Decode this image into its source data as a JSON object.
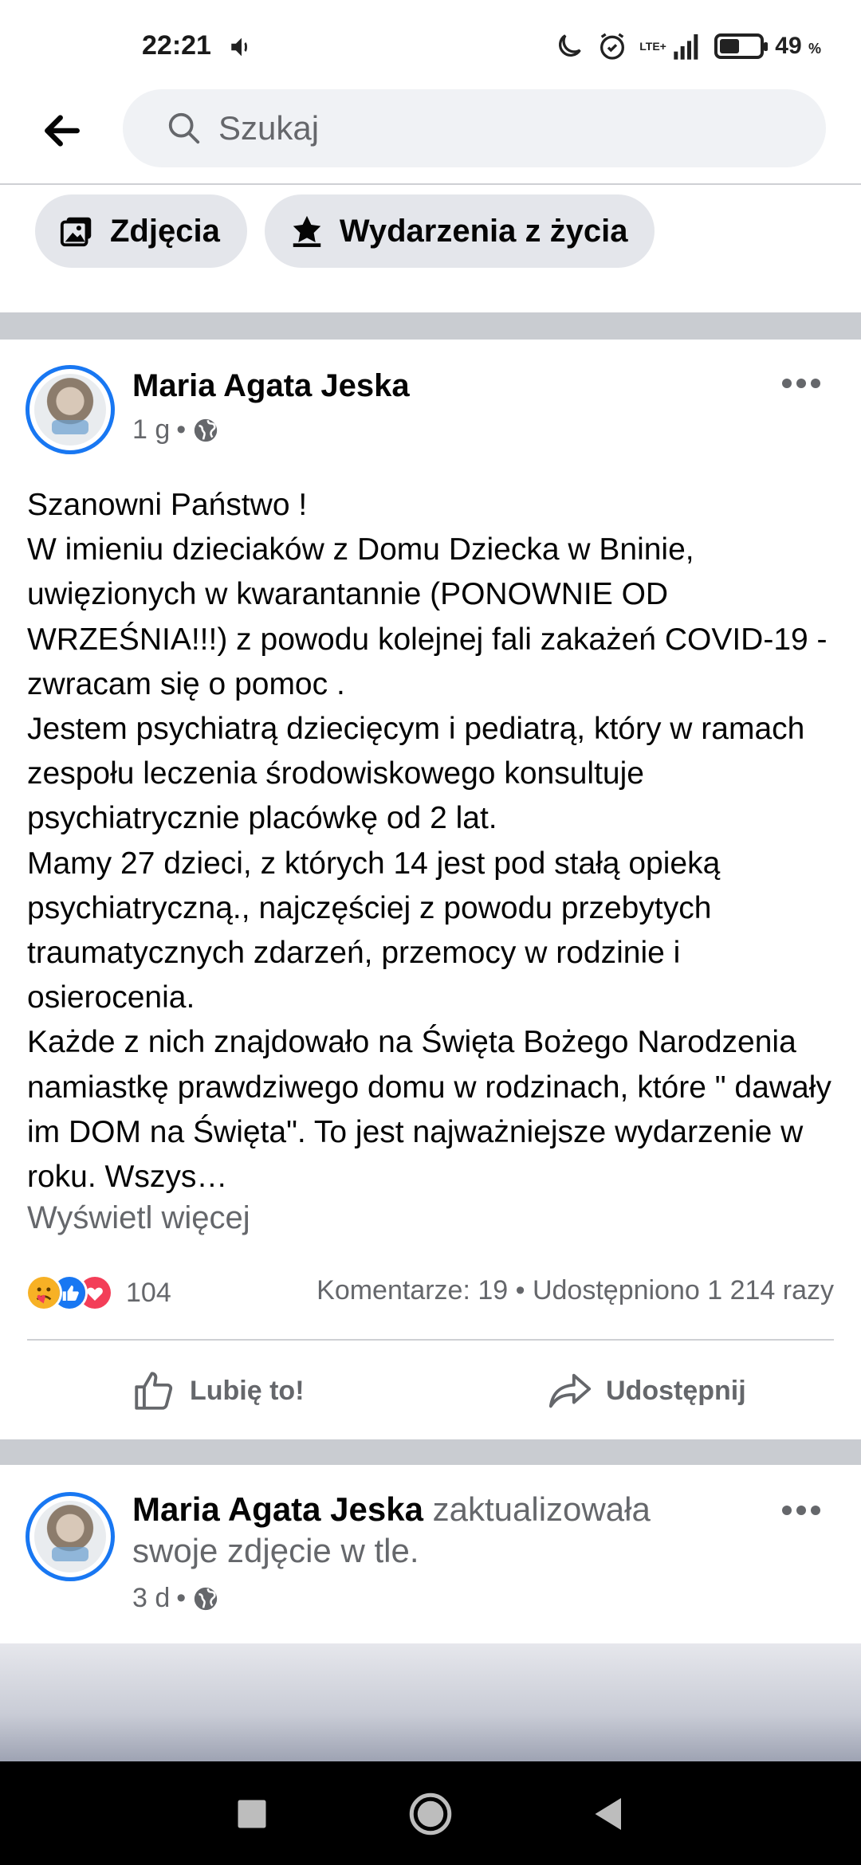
{
  "status_bar": {
    "time": "22:21",
    "network": "LTE+",
    "battery_percent": "49",
    "battery_unit": "%",
    "battery_level": 0.49,
    "icons": [
      "volume-icon",
      "moon-icon",
      "alarm-icon",
      "signal-icon",
      "battery-icon"
    ]
  },
  "search": {
    "placeholder": "Szukaj"
  },
  "chips": [
    {
      "label": "Zdjęcia",
      "icon": "photos-icon"
    },
    {
      "label": "Wydarzenia z życia",
      "icon": "life-event-star-icon"
    }
  ],
  "post": {
    "author": "Maria Agata Jeska",
    "time": "1 g",
    "separator": "•",
    "body": "Szanowni Państwo !\nW imieniu dzieciaków z Domu Dziecka w Bninie, uwięzionych w kwarantannie (PONOWNIE OD WRZEŚNIA!!!) z powodu kolejnej fali zakażeń COVID-19 - zwracam się o pomoc .\nJestem psychiatrą dziecięcym i pediatrą, który w ramach zespołu leczenia środowiskowego konsultuje psychiatrycznie placówkę od 2 lat.\nMamy 27 dzieci, z których 14 jest pod stałą opieką psychiatryczną., najczęściej z powodu przebytych traumatycznych zdarzeń, przemocy w rodzinie i osierocenia.\nKażde z nich znajdowało na Święta Bożego Narodzenia namiastkę prawdziwego domu w rodzinach, które \" dawały im DOM na Święta\". To jest najważniejsze wydarzenie w roku. Wszys…",
    "see_more": "Wyświetl więcej",
    "reaction_count": "104",
    "reactions": [
      "care-reaction-icon",
      "like-reaction-icon",
      "love-reaction-icon"
    ],
    "stats": "Komentarze: 19 • Udostępniono 1 214 razy",
    "like_label": "Lubię to!",
    "share_label": "Udostępnij"
  },
  "post2": {
    "author": "Maria Agata Jeska",
    "action": " zaktualizowała swoje zdjęcie w tle.",
    "time": "3 d",
    "separator": "•"
  },
  "colors": {
    "accent": "#1877f2",
    "secondary_text": "#65676b",
    "chip_bg": "#e4e6eb",
    "search_bg": "#f0f2f5",
    "divider": "#c9ccd1",
    "love": "#f33e58",
    "care": "#f7b125"
  }
}
